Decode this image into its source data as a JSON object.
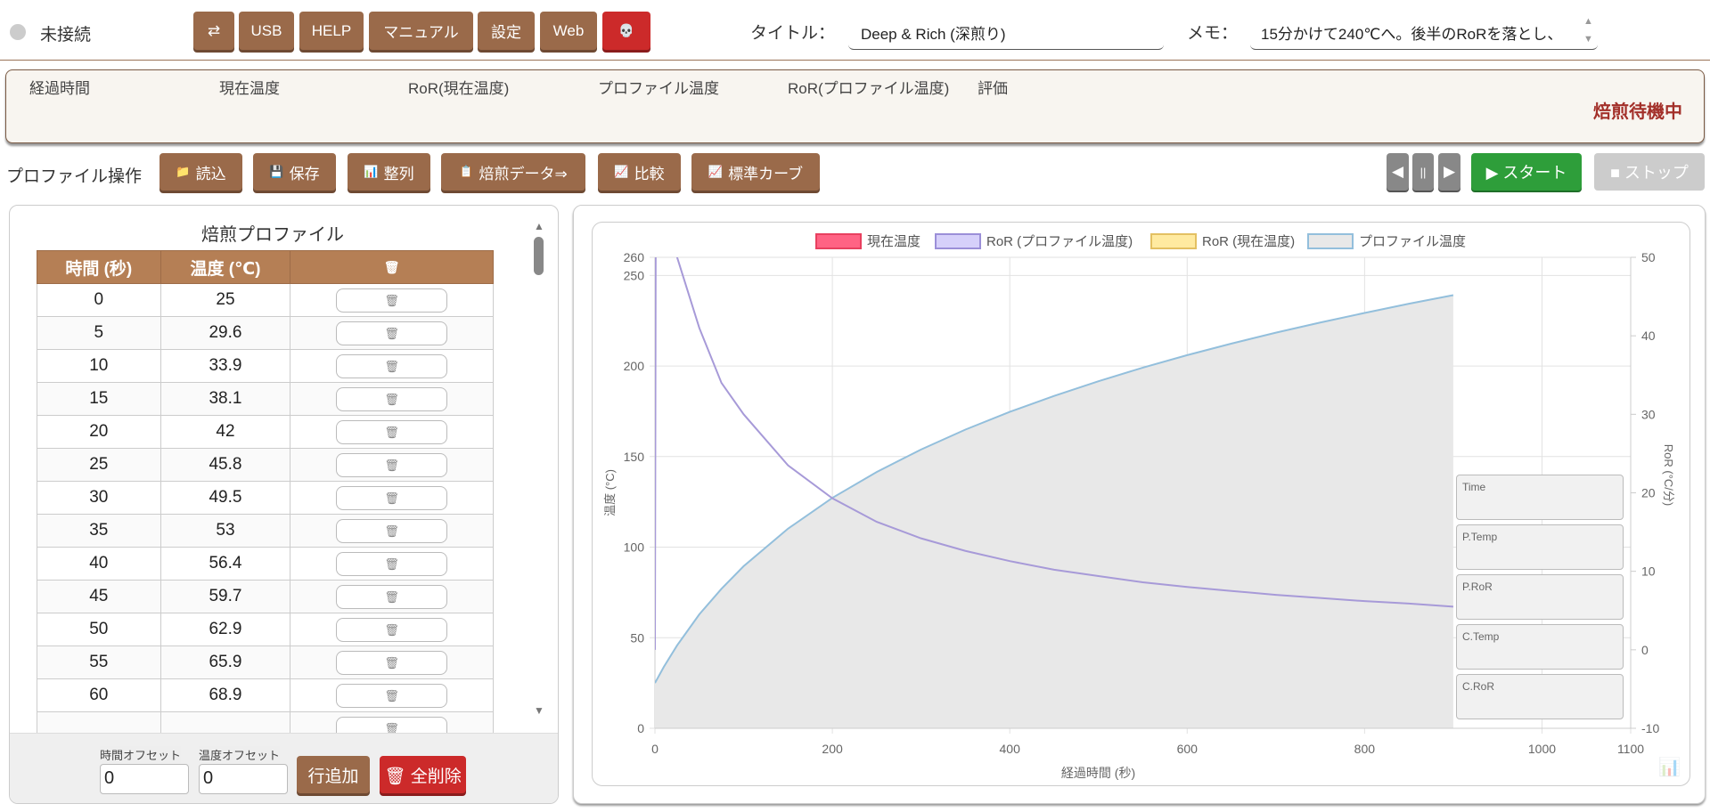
{
  "header": {
    "status": "未接続",
    "buttons": [
      "⇄",
      "USB",
      "HELP",
      "マニュアル",
      "設定",
      "Web",
      "💀"
    ],
    "title_label": "タイトル：",
    "title_value": "Deep & Rich (深煎り)",
    "memo_label": "メモ：",
    "memo_value": "15分かけて240℃へ。後半のRoRを落とし、"
  },
  "info": {
    "columns": [
      "経過時間",
      "現在温度",
      "RoR(現在温度)",
      "プロファイル温度",
      "RoR(プロファイル温度)",
      "評価"
    ],
    "state": "焙煎待機中"
  },
  "ops": {
    "label": "プロファイル操作",
    "buttons": [
      {
        "icon": "📁",
        "label": "読込"
      },
      {
        "icon": "💾",
        "label": "保存"
      },
      {
        "icon": "📊",
        "label": "整列"
      },
      {
        "icon": "📋",
        "label": "焙煎データ⇒"
      },
      {
        "icon": "📈",
        "label": "比較"
      },
      {
        "icon": "📈",
        "label": "標準カーブ"
      }
    ],
    "prev": "◀",
    "pause": "||",
    "next": "▶",
    "start": "▶ スタート",
    "stop": "■ ストップ"
  },
  "profile": {
    "title": "焙煎プロファイル",
    "headers": [
      "時間 (秒)",
      "温度 (℃)",
      "🗑"
    ],
    "delete_icon": "🗑",
    "rows": [
      [
        0,
        25
      ],
      [
        5,
        29.6
      ],
      [
        10,
        33.9
      ],
      [
        15,
        38.1
      ],
      [
        20,
        42
      ],
      [
        25,
        45.8
      ],
      [
        30,
        49.5
      ],
      [
        35,
        53
      ],
      [
        40,
        56.4
      ],
      [
        45,
        59.7
      ],
      [
        50,
        62.9
      ],
      [
        55,
        65.9
      ],
      [
        60,
        68.9
      ]
    ],
    "time_offset_label": "時間オフセット",
    "time_offset": "0",
    "temp_offset_label": "温度オフセット",
    "temp_offset": "0",
    "add_row": "行追加",
    "delete_all": "🗑 全削除"
  },
  "chart_data": {
    "type": "line",
    "legend": [
      {
        "label": "現在温度",
        "fill": "#ff6384",
        "border": "#e8405f"
      },
      {
        "label": "RoR (プロファイル温度)",
        "fill": "#d6d0fa",
        "border": "#9b8fd8"
      },
      {
        "label": "RoR (現在温度)",
        "fill": "#ffeaa0",
        "border": "#e3c062"
      },
      {
        "label": "プロファイル温度",
        "fill": "#e8e8e8",
        "border": "#93bfdc"
      }
    ],
    "xlabel": "経過時間 (秒)",
    "ylabel": "温度 (°C)",
    "y2label": "RoR (°C/分)",
    "xlim": [
      0,
      1100
    ],
    "ylim": [
      0,
      260
    ],
    "y2lim": [
      -10,
      50
    ],
    "xticks": [
      0,
      200,
      400,
      600,
      800,
      1000,
      1100
    ],
    "yticks": [
      0,
      50,
      100,
      150,
      200,
      250,
      260
    ],
    "y2ticks": [
      -10,
      0,
      10,
      20,
      30,
      40,
      50
    ],
    "series": [
      {
        "name": "プロファイル温度",
        "axis": "left",
        "color": "#93bfdc",
        "fill": "#e8e8e8",
        "points": [
          [
            0,
            25
          ],
          [
            10,
            33.9
          ],
          [
            25,
            45.8
          ],
          [
            50,
            62.9
          ],
          [
            75,
            77
          ],
          [
            100,
            89.5
          ],
          [
            150,
            110.2
          ],
          [
            200,
            127.2
          ],
          [
            250,
            141.5
          ],
          [
            300,
            153.9
          ],
          [
            350,
            164.9
          ],
          [
            400,
            174.7
          ],
          [
            450,
            183.5
          ],
          [
            500,
            191.6
          ],
          [
            550,
            199.1
          ],
          [
            600,
            206
          ],
          [
            650,
            212.4
          ],
          [
            700,
            218.4
          ],
          [
            750,
            224
          ],
          [
            800,
            229.3
          ],
          [
            850,
            234.4
          ],
          [
            900,
            239.1
          ]
        ]
      },
      {
        "name": "RoR (プロファイル温度)",
        "axis": "right",
        "color": "#a79ad8",
        "points": [
          [
            0,
            0
          ],
          [
            1,
            60
          ],
          [
            25,
            50
          ],
          [
            50,
            41
          ],
          [
            75,
            34
          ],
          [
            100,
            30
          ],
          [
            150,
            23.5
          ],
          [
            200,
            19.3
          ],
          [
            250,
            16.3
          ],
          [
            300,
            14.2
          ],
          [
            350,
            12.6
          ],
          [
            400,
            11.3
          ],
          [
            450,
            10.2
          ],
          [
            500,
            9.4
          ],
          [
            550,
            8.6
          ],
          [
            600,
            8
          ],
          [
            650,
            7.5
          ],
          [
            700,
            7
          ],
          [
            750,
            6.6
          ],
          [
            800,
            6.2
          ],
          [
            850,
            5.9
          ],
          [
            900,
            5.5
          ]
        ]
      }
    ],
    "readouts": [
      "Time",
      "P.Temp",
      "P.RoR",
      "C.Temp",
      "C.RoR"
    ]
  }
}
